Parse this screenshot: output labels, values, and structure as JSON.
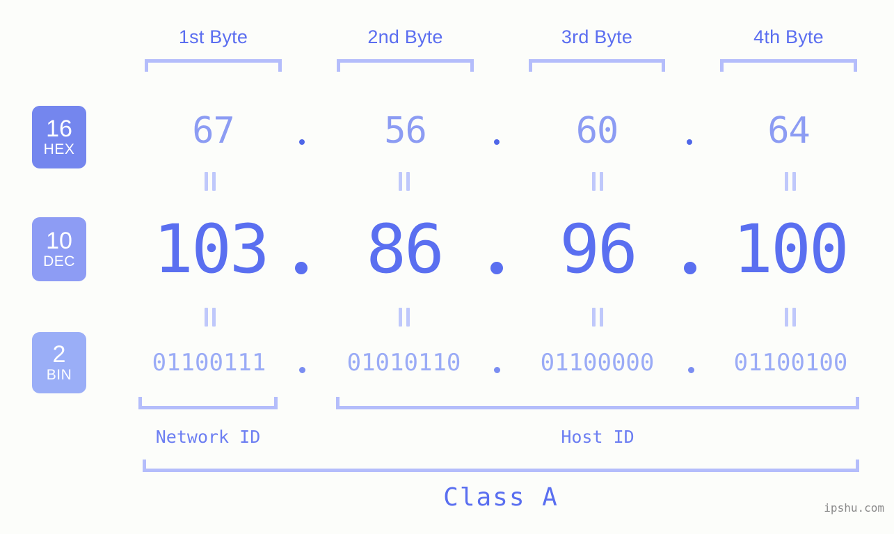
{
  "background_color": "#fcfdfa",
  "accent_colors": {
    "header_blue": "#5b6ef0",
    "bracket_blue": "#b4bdfb",
    "hex_badge": "#7486ee",
    "dec_badge": "#8d9cf4",
    "bin_badge": "#9aaef7",
    "hex_text": "#8c9cf3",
    "dec_text": "#5a6ff0",
    "bin_text": "#9aabf6",
    "watermark_gray": "#8a8a8a"
  },
  "byte_headers": [
    {
      "label": "1st Byte"
    },
    {
      "label": "2nd Byte"
    },
    {
      "label": "3rd Byte"
    },
    {
      "label": "4th Byte"
    }
  ],
  "radix_badges": [
    {
      "base": "16",
      "name": "HEX"
    },
    {
      "base": "10",
      "name": "DEC"
    },
    {
      "base": "2",
      "name": "BIN"
    }
  ],
  "rows": {
    "hex": {
      "base": "16",
      "name": "HEX",
      "octets": [
        "67",
        "56",
        "60",
        "64"
      ],
      "separator": "."
    },
    "dec": {
      "base": "10",
      "name": "DEC",
      "octets": [
        "103",
        "86",
        "96",
        "100"
      ],
      "separator": "."
    },
    "bin": {
      "base": "2",
      "name": "BIN",
      "octets": [
        "01100111",
        "01010110",
        "01100000",
        "01100100"
      ],
      "separator": "."
    }
  },
  "equals_marker": "||",
  "segments": {
    "network_id_label": "Network ID",
    "host_id_label": "Host ID",
    "class_label": "Class A"
  },
  "watermark": "ipshu.com"
}
